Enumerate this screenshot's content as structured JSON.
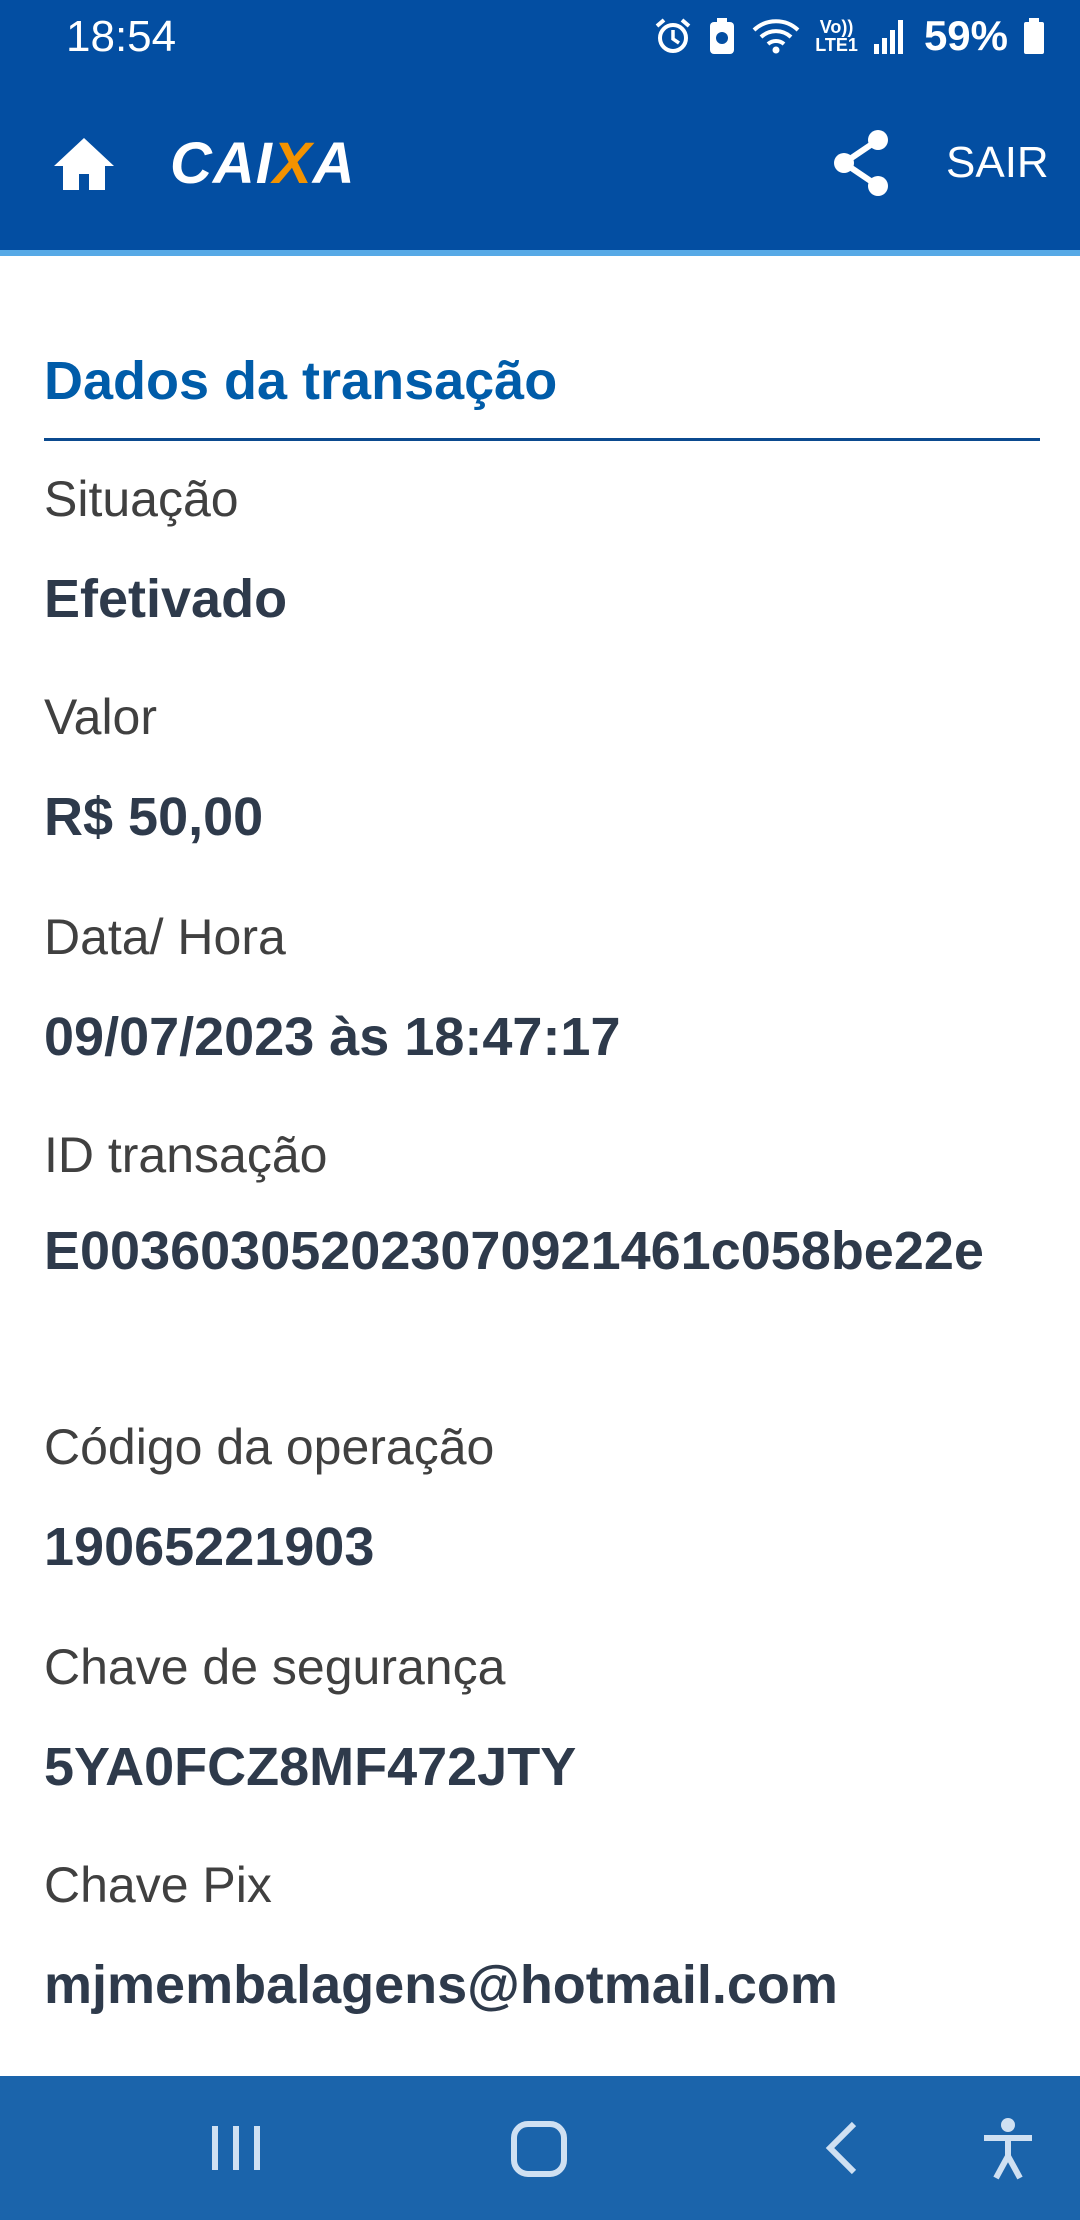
{
  "status_bar": {
    "time": "18:54",
    "battery": "59%",
    "network_label_top": "Vo))",
    "network_label_bottom": "LTE1"
  },
  "header": {
    "logo_text_pre": "CAI",
    "logo_text_x": "X",
    "logo_text_post": "A",
    "logout_label": "SAIR",
    "brand_color": "#034ea2",
    "accent_color": "#f39200"
  },
  "transaction": {
    "title": "Dados da transação",
    "fields": [
      {
        "label": "Situação",
        "value": "Efetivado"
      },
      {
        "label": "Valor",
        "value": "R$ 50,00"
      },
      {
        "label": "Data/ Hora",
        "value": "09/07/2023 às 18:47:17"
      },
      {
        "label": "ID transação",
        "value": "E003603052023070921461c058be22e"
      },
      {
        "label": "Código da operação",
        "value": "19065221903"
      },
      {
        "label": "Chave de segurança",
        "value": "5YA0FCZ8MF472JTY"
      },
      {
        "label": "Chave Pix",
        "value": "mjmembalagens@hotmail.com"
      }
    ]
  },
  "nav_bar": {
    "icons": [
      "recent-apps-icon",
      "home-icon",
      "back-icon",
      "accessibility-icon"
    ]
  }
}
